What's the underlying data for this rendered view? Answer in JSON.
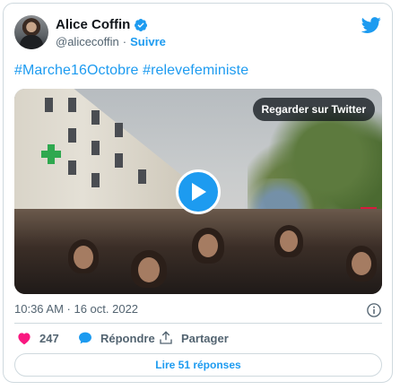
{
  "tweet": {
    "author_name": "Alice Coffin",
    "handle": "@alicecoffin",
    "separator": "·",
    "follow_label": "Suivre",
    "hashtags": "#Marche16Octobre #relevefeministe",
    "timestamp": "10:36 AM · 16 oct. 2022",
    "likes_count": "247",
    "reply_label": "Répondre",
    "share_label": "Partager",
    "read_replies_label": "Lire 51 réponses"
  },
  "media": {
    "view_on_twitter_label": "Regarder sur Twitter"
  },
  "colors": {
    "accent": "#1d9bf0",
    "like": "#f91880",
    "muted_text": "#536471",
    "border": "#cfd9de"
  },
  "icons": {
    "verified": "verified-badge-icon",
    "logo": "twitter-bird-icon",
    "play": "play-icon",
    "info": "info-icon",
    "like": "heart-icon",
    "reply": "speech-bubble-icon",
    "share": "share-icon"
  }
}
